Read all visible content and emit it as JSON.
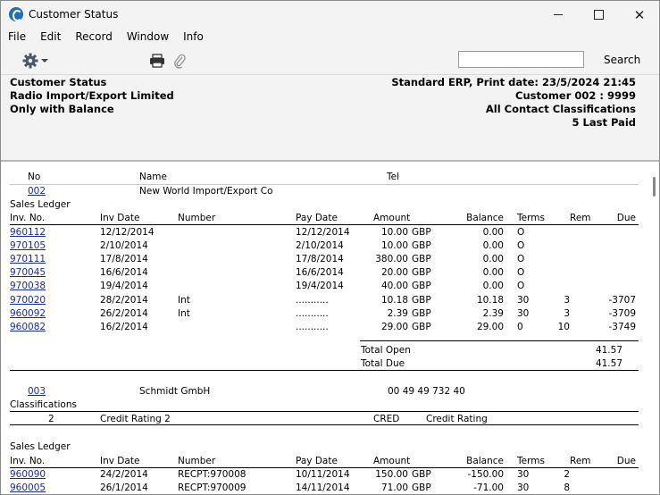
{
  "window": {
    "title": "Customer Status"
  },
  "menu": [
    "File",
    "Edit",
    "Record",
    "Window",
    "Info"
  ],
  "toolbar": {
    "search_value": "",
    "search_label": "Search"
  },
  "header": {
    "left": [
      "Customer Status",
      "Radio Import/Export Limited",
      "Only with Balance"
    ],
    "right": [
      "Standard ERP, Print date: 23/5/2024 21:45",
      "Customer 002 : 9999",
      "All Contact Classifications",
      "5 Last Paid"
    ]
  },
  "columns": {
    "no": "No",
    "name": "Name",
    "tel": "Tel"
  },
  "ledger_cols": {
    "inv_no": "Inv. No.",
    "inv_date": "Inv Date",
    "number": "Number",
    "pay_date": "Pay Date",
    "amount": "Amount",
    "balance": "Balance",
    "terms": "Terms",
    "rem": "Rem",
    "due": "Due"
  },
  "customers": [
    {
      "no": "002",
      "name": "New World Import/Export Co",
      "tel": "",
      "section": "Sales Ledger",
      "rows": [
        {
          "inv": "960112",
          "date": "12/12/2014",
          "number": "",
          "pay": "12/12/2014",
          "amount": "10.00",
          "cur": "GBP",
          "balance": "0.00",
          "terms": "O",
          "rem": "",
          "due": ""
        },
        {
          "inv": "970105",
          "date": "2/10/2014",
          "number": "",
          "pay": "2/10/2014",
          "amount": "10.00",
          "cur": "GBP",
          "balance": "0.00",
          "terms": "O",
          "rem": "",
          "due": ""
        },
        {
          "inv": "970111",
          "date": "17/8/2014",
          "number": "",
          "pay": "17/8/2014",
          "amount": "380.00",
          "cur": "GBP",
          "balance": "0.00",
          "terms": "O",
          "rem": "",
          "due": ""
        },
        {
          "inv": "970045",
          "date": "16/6/2014",
          "number": "",
          "pay": "16/6/2014",
          "amount": "20.00",
          "cur": "GBP",
          "balance": "0.00",
          "terms": "O",
          "rem": "",
          "due": ""
        },
        {
          "inv": "970038",
          "date": "19/4/2014",
          "number": "",
          "pay": "19/4/2014",
          "amount": "40.00",
          "cur": "GBP",
          "balance": "0.00",
          "terms": "O",
          "rem": "",
          "due": ""
        },
        {
          "inv": "970020",
          "date": "28/2/2014",
          "number": "Int",
          "pay": "...........",
          "amount": "10.18",
          "cur": "GBP",
          "balance": "10.18",
          "terms": "30",
          "rem": "3",
          "due": "-3707"
        },
        {
          "inv": "960092",
          "date": "26/2/2014",
          "number": "Int",
          "pay": "...........",
          "amount": "2.39",
          "cur": "GBP",
          "balance": "2.39",
          "terms": "30",
          "rem": "3",
          "due": "-3709"
        },
        {
          "inv": "960082",
          "date": "16/2/2014",
          "number": "",
          "pay": "...........",
          "amount": "29.00",
          "cur": "GBP",
          "balance": "29.00",
          "terms": "0",
          "rem": "10",
          "due": "-3749"
        }
      ],
      "total_open_label": "Total Open",
      "total_open": "41.57",
      "total_due_label": "Total Due",
      "total_due": "41.57"
    },
    {
      "no": "003",
      "name": "Schmidt GmbH",
      "tel": "00 49 49 732 40",
      "classifications_label": "Classifications",
      "classification": {
        "num": "2",
        "name": "Credit Rating 2",
        "code": "CRED",
        "desc": "Credit Rating"
      },
      "section": "Sales Ledger",
      "rows": [
        {
          "inv": "960090",
          "date": "24/2/2014",
          "number": "RECPT:970008",
          "pay": "10/11/2014",
          "amount": "150.00",
          "cur": "GBP",
          "balance": "-150.00",
          "terms": "30",
          "rem": "2",
          "due": ""
        },
        {
          "inv": "960005",
          "date": "26/1/2014",
          "number": "RECPT:970009",
          "pay": "14/11/2014",
          "amount": "71.00",
          "cur": "GBP",
          "balance": "-71.00",
          "terms": "30",
          "rem": "8",
          "due": ""
        }
      ]
    }
  ]
}
